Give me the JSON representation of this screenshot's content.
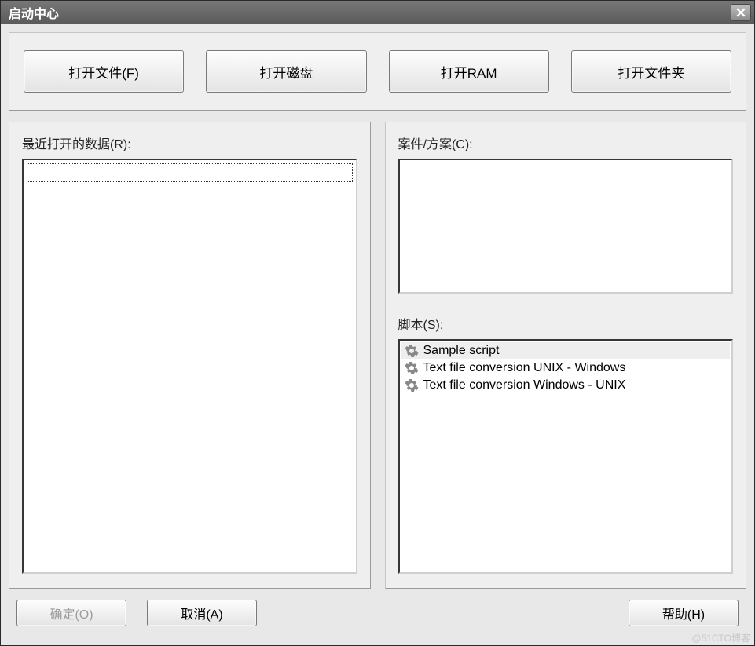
{
  "title": "启动中心",
  "toolbar": {
    "open_file": "打开文件(F)",
    "open_disk": "打开磁盘",
    "open_ram": "打开RAM",
    "open_folder": "打开文件夹"
  },
  "left": {
    "recent_label": "最近打开的数据(R):"
  },
  "right": {
    "cases_label": "案件/方案(C):",
    "scripts_label": "脚本(S):",
    "scripts": [
      {
        "name": "Sample script",
        "selected": true
      },
      {
        "name": "Text file conversion UNIX - Windows",
        "selected": false
      },
      {
        "name": "Text file conversion Windows - UNIX",
        "selected": false
      }
    ]
  },
  "footer": {
    "ok": "确定(O)",
    "cancel": "取消(A)",
    "help": "帮助(H)"
  },
  "watermark": "@51CTO博客"
}
